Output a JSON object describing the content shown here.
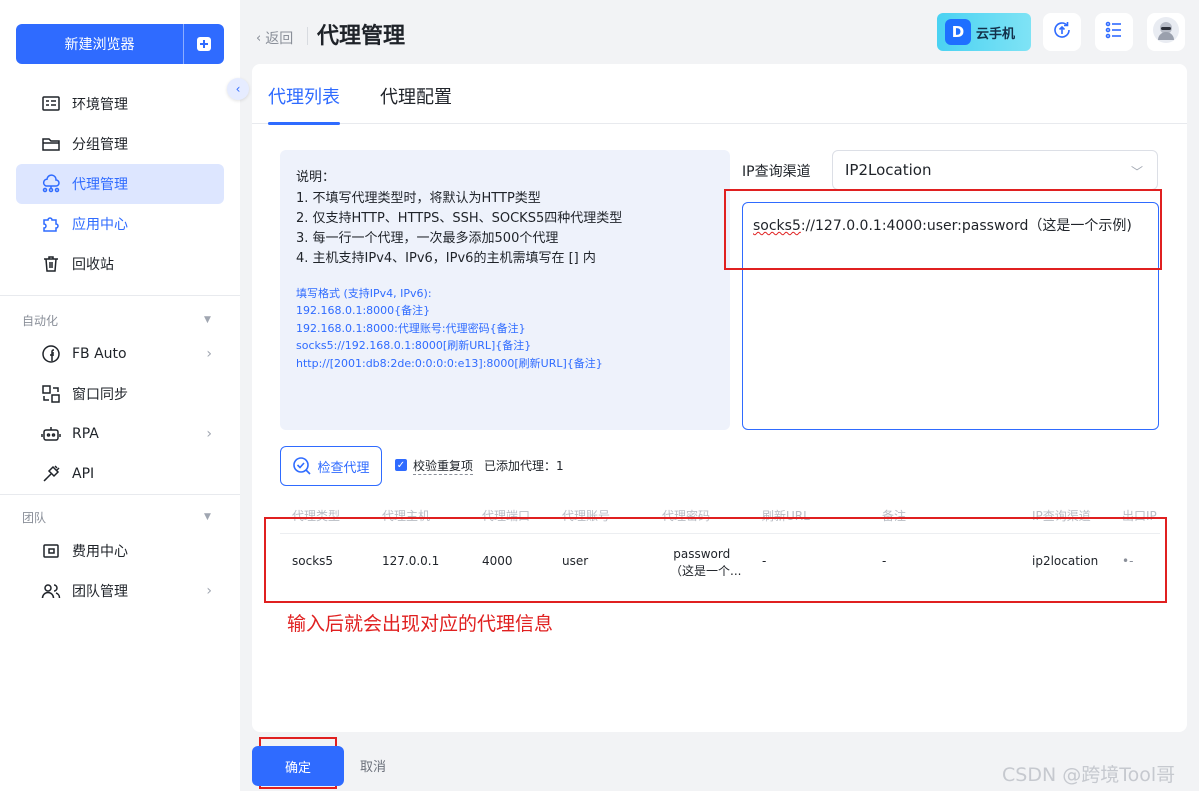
{
  "sidebar": {
    "new_browser_label": "新建浏览器",
    "items": [
      {
        "label": "环境管理",
        "icon": "monitor-list-icon"
      },
      {
        "label": "分组管理",
        "icon": "folder-icon"
      },
      {
        "label": "代理管理",
        "icon": "cloud-network-icon"
      },
      {
        "label": "应用中心",
        "icon": "puzzle-icon"
      },
      {
        "label": "回收站",
        "icon": "trash-icon"
      }
    ],
    "automation_title": "自动化",
    "automation_items": [
      {
        "label": "FB Auto",
        "icon": "facebook-icon"
      },
      {
        "label": "窗口同步",
        "icon": "window-sync-icon"
      },
      {
        "label": "RPA",
        "icon": "robot-icon"
      },
      {
        "label": "API",
        "icon": "plug-icon"
      }
    ],
    "team_title": "团队",
    "team_items": [
      {
        "label": "费用中心",
        "icon": "wallet-icon"
      },
      {
        "label": "团队管理",
        "icon": "users-icon"
      }
    ]
  },
  "header": {
    "back_label": "返回",
    "title": "代理管理",
    "cloud_phone_label": "云手机"
  },
  "tabs": [
    {
      "label": "代理列表"
    },
    {
      "label": "代理配置"
    }
  ],
  "info": {
    "title": "说明：",
    "lines": [
      "1. 不填写代理类型时，将默认为HTTP类型",
      "2. 仅支持HTTP、HTTPS、SSH、SOCKS5四种代理类型",
      "3. 每一行一个代理，一次最多添加500个代理",
      "4. 主机支持IPv4、IPv6，IPv6的主机需填写在 [] 内"
    ],
    "format_title": "填写格式 (支持IPv4, IPv6):",
    "format_lines": [
      "192.168.0.1:8000{备注}",
      "192.168.0.1:8000:代理账号:代理密码{备注}",
      "socks5://192.168.0.1:8000[刷新URL]{备注}",
      "http://[2001:db8:2de:0:0:0:0:e13]:8000[刷新URL]{备注}"
    ]
  },
  "ip_channel": {
    "label": "IP查询渠道",
    "selected": "IP2Location"
  },
  "proxy_input": {
    "prefix": "socks5",
    "rest": "://127.0.0.1:4000:user:password（这是一个示例)"
  },
  "actions": {
    "check_proxy_label": "检查代理",
    "dedupe_label": "校验重复项",
    "added_count_label": "已添加代理：1"
  },
  "table": {
    "headers": [
      "代理类型",
      "代理主机",
      "代理端口",
      "代理账号",
      "代理密码",
      "刷新URL",
      "备注",
      "IP查询渠道",
      "出口IP"
    ],
    "row": {
      "type": "socks5",
      "host": "127.0.0.1",
      "port": "4000",
      "account": "user",
      "password_line1": "password",
      "password_line2": "（这是一个...",
      "refresh_url": "-",
      "note": "-",
      "channel": "ip2location",
      "exit_ip": "•-"
    }
  },
  "annotation": "输入后就会出现对应的代理信息",
  "footer": {
    "ok_label": "确定",
    "cancel_label": "取消"
  },
  "watermark": "CSDN @跨境Tool哥",
  "colors": {
    "accent": "#2f6bff",
    "annotation_red": "#e02020"
  }
}
